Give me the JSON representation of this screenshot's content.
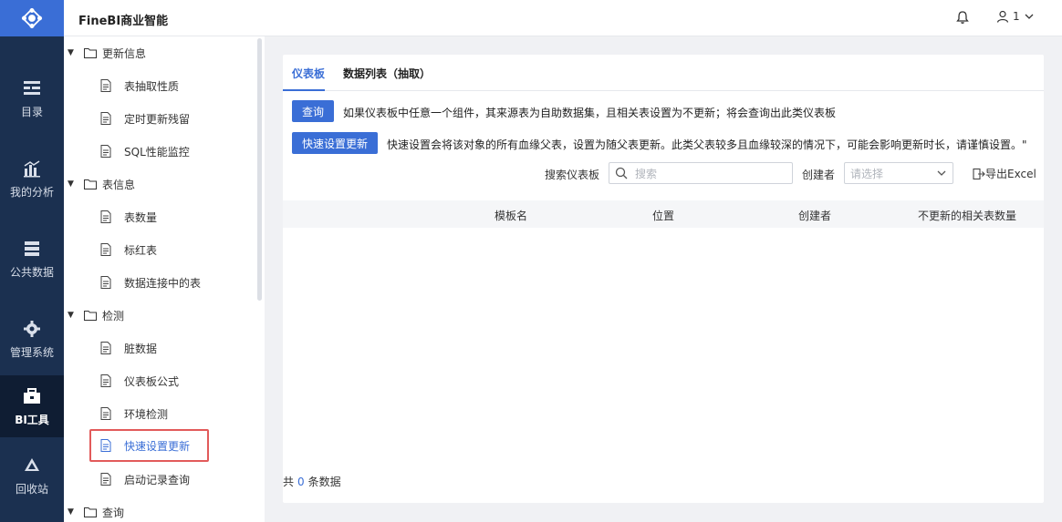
{
  "app": {
    "title": "FineBI商业智能"
  },
  "header": {
    "user_name": "1"
  },
  "rail": {
    "items": [
      {
        "label": "目录",
        "icon": "catalog-icon"
      },
      {
        "label": "我的分析",
        "icon": "analysis-icon"
      },
      {
        "label": "公共数据",
        "icon": "database-icon"
      },
      {
        "label": "管理系统",
        "icon": "gear-icon"
      },
      {
        "label": "BI工具",
        "icon": "toolbox-icon",
        "active": true
      },
      {
        "label": "回收站",
        "icon": "recycle-icon"
      }
    ]
  },
  "tree": {
    "groups": [
      {
        "label": "更新信息",
        "children": [
          "表抽取性质",
          "定时更新残留",
          "SQL性能监控"
        ]
      },
      {
        "label": "表信息",
        "children": [
          "表数量",
          "标红表",
          "数据连接中的表"
        ]
      },
      {
        "label": "检测",
        "children": [
          "脏数据",
          "仪表板公式",
          "环境检测",
          "快速设置更新",
          "启动记录查询"
        ]
      },
      {
        "label": "查询",
        "children": []
      }
    ]
  },
  "main": {
    "tabs": [
      "仪表板",
      "数据列表（抽取）"
    ],
    "query_button": "查询",
    "query_desc": "如果仪表板中任意一个组件，其来源表为自助数据集，且相关表设置为不更新；将会查询出此类仪表板",
    "quick_button": "快速设置更新",
    "quick_desc": "快速设置会将该对象的所有血缘父表，设置为随父表更新。此类父表较多且血缘较深的情况下，可能会影响更新时长，请谨慎设置。\"",
    "search_label": "搜索仪表板",
    "search_placeholder": "搜索",
    "creator_label": "创建者",
    "creator_placeholder": "请选择",
    "export_label": "导出Excel",
    "columns": [
      "模板名",
      "位置",
      "创建者",
      "不更新的相关表数量"
    ],
    "total_prefix": "共",
    "total_count": "0",
    "total_suffix": "条数据"
  },
  "colors": {
    "accent": "#3a6ed6",
    "rail_bg": "#1b3050",
    "highlight_border": "#e25a5a"
  }
}
